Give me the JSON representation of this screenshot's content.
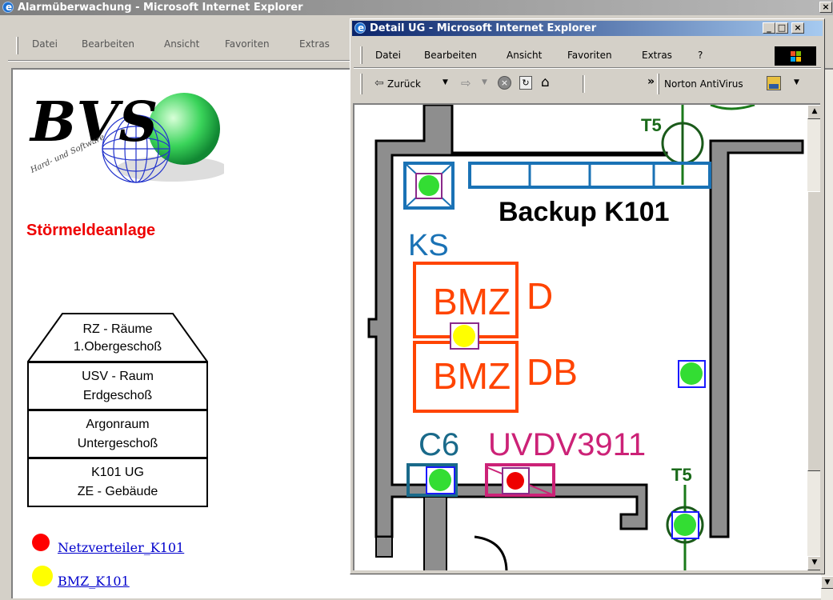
{
  "bg_window": {
    "title": "Alarmüberwachung - Microsoft Internet Explorer",
    "menu": [
      "Datei",
      "Bearbeiten",
      "Ansicht",
      "Favoriten",
      "Extras"
    ],
    "heading": "Störmeldeanlage",
    "logo_text": "BVS",
    "logo_sub": "Hard- und Software",
    "nav": [
      {
        "line1": "RZ - Räume",
        "line2": "1.Obergeschoß"
      },
      {
        "line1": "USV - Raum",
        "line2": "Erdgeschoß"
      },
      {
        "line1": "Argonraum",
        "line2": "Untergeschoß"
      },
      {
        "line1": "K101 UG",
        "line2": "ZE - Gebäude"
      }
    ],
    "alarms": [
      {
        "label": "Netzverteiler_K101",
        "color": "#ff0000"
      },
      {
        "label": "BMZ_K101",
        "color": "#ffff00"
      }
    ]
  },
  "detail_window": {
    "title": "Detail UG - Microsoft Internet Explorer",
    "menu": [
      "Datei",
      "Bearbeiten",
      "Ansicht",
      "Favoriten",
      "Extras",
      "?"
    ],
    "back_label": "Zurück",
    "norton_label": "Norton AntiVirus",
    "chevron": "»",
    "minimize": "_",
    "maximize": "□",
    "close": "×"
  },
  "floorplan": {
    "room_title": "Backup K101",
    "labels": {
      "ks": "KS",
      "bmz1": "BMZ",
      "bmz2": "BMZ",
      "d": "D",
      "db": "DB",
      "c6": "C6",
      "uvdv": "UVDV3911",
      "t5_top": "T5",
      "t5_bottom": "T5"
    },
    "status_colors": {
      "ok": "#33dd33",
      "alarm": "#ee0000",
      "warning": "#ffff00"
    }
  }
}
